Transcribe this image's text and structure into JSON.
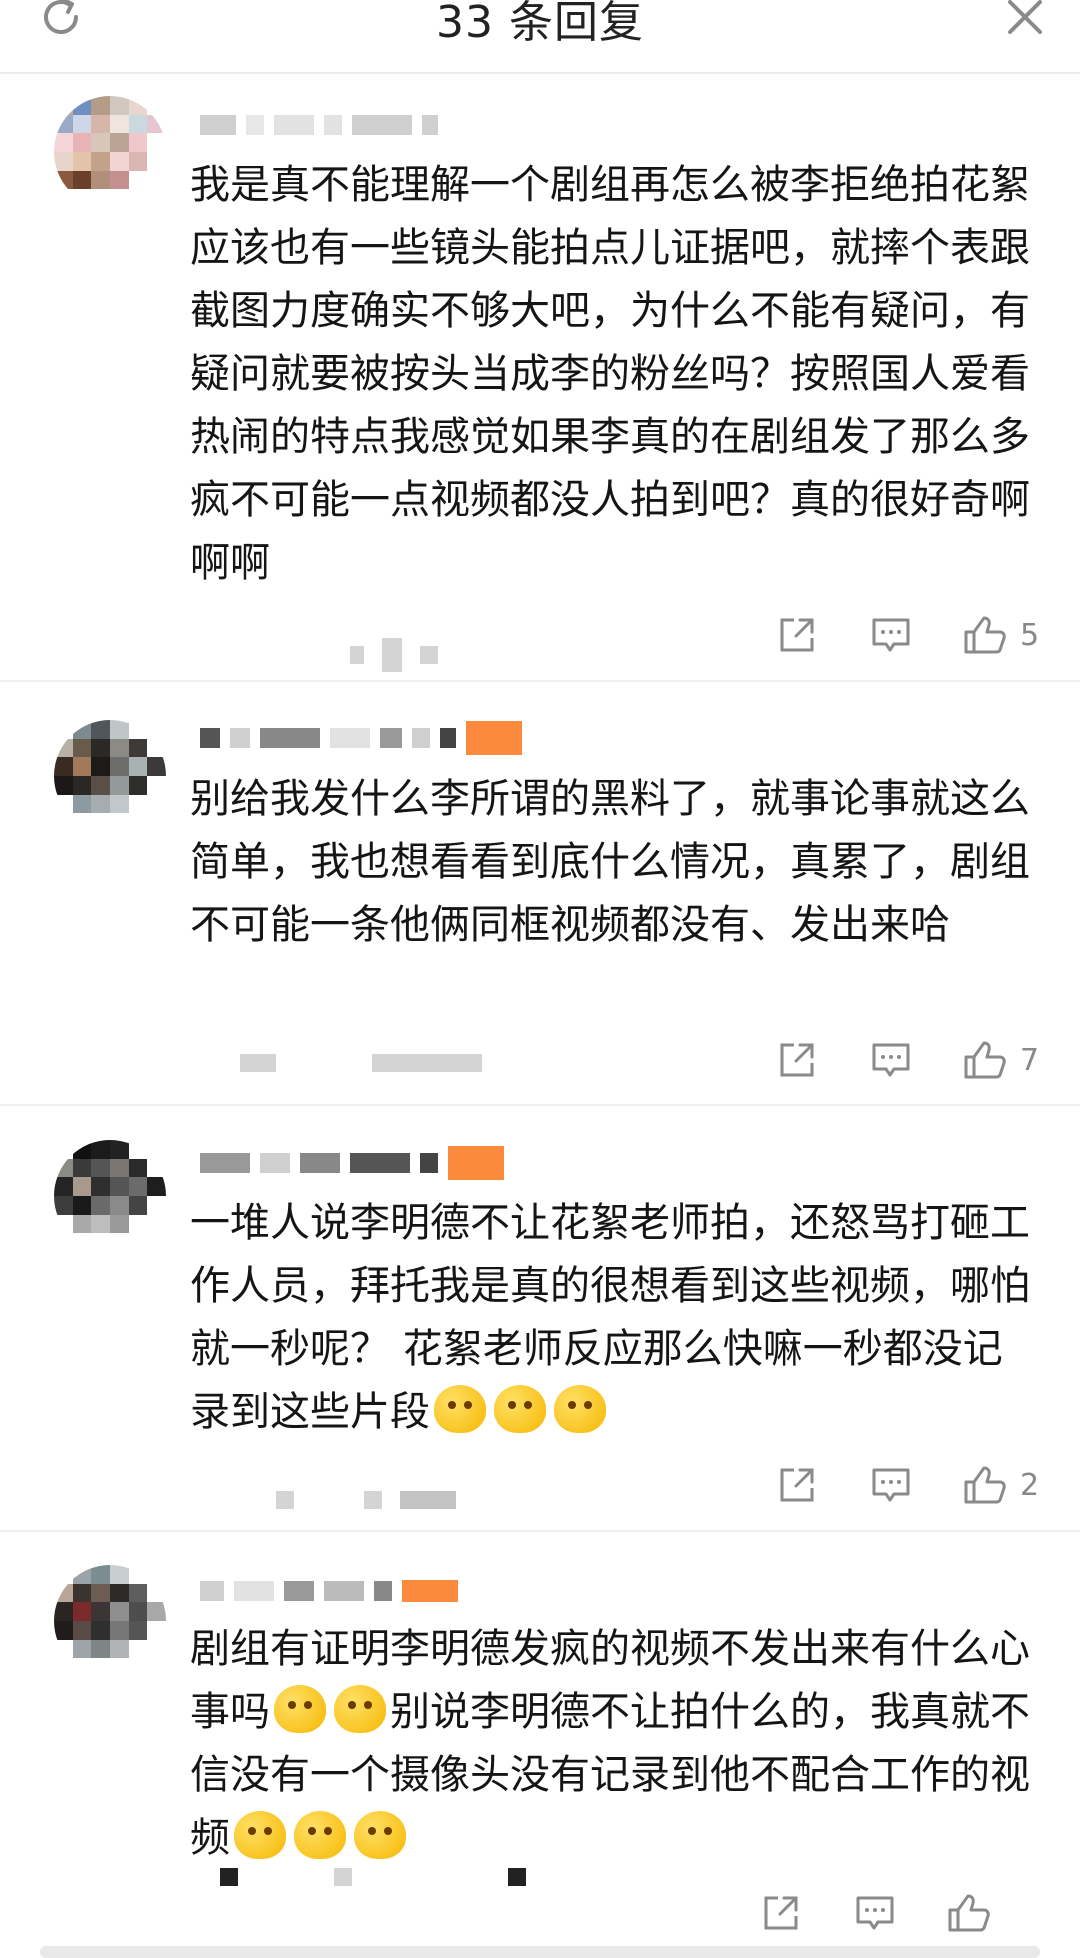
{
  "header": {
    "title": "33 条回复"
  },
  "comments": [
    {
      "text": "我是真不能理解一个剧组再怎么被李拒绝拍花絮应该也有一些镜头能拍点儿证据吧，就摔个表跟截图力度确实不够大吧，为什么不能有疑问，有疑问就要被按头当成李的粉丝吗？按照国人爱看热闹的特点我感觉如果李真的在剧组发了那么多疯不可能一点视频都没人拍到吧？真的很好奇啊啊啊",
      "likes": "5"
    },
    {
      "text": "别给我发什么李所谓的黑料了，就事论事就这么简单，我也想看看到底什么情况，真累了，剧组不可能一条他俩同框视频都没有、发出来哈",
      "likes": "7"
    },
    {
      "text": "一堆人说李明德不让花絮老师拍，还怒骂打砸工作人员，拜托我是真的很想看到这些视频，哪怕就一秒呢？ 花絮老师反应那么快嘛一秒都没记录到这些片段",
      "likes": "2"
    },
    {
      "text_a": "剧组有证明李明德发疯的视频不发出来有什么心事吗",
      "text_b": "别说李明德不让拍什么的，我真就不信没有一个摄像头没有记录到他不配合工作的视频",
      "likes": ""
    }
  ],
  "colors": {
    "badge": "#fb8a3c",
    "divider": "#f0f0f0",
    "icon": "#8a8a8a"
  },
  "icons": [
    "refresh-icon",
    "close-icon",
    "share-icon",
    "comment-icon",
    "like-icon",
    "emoji-icon"
  ]
}
